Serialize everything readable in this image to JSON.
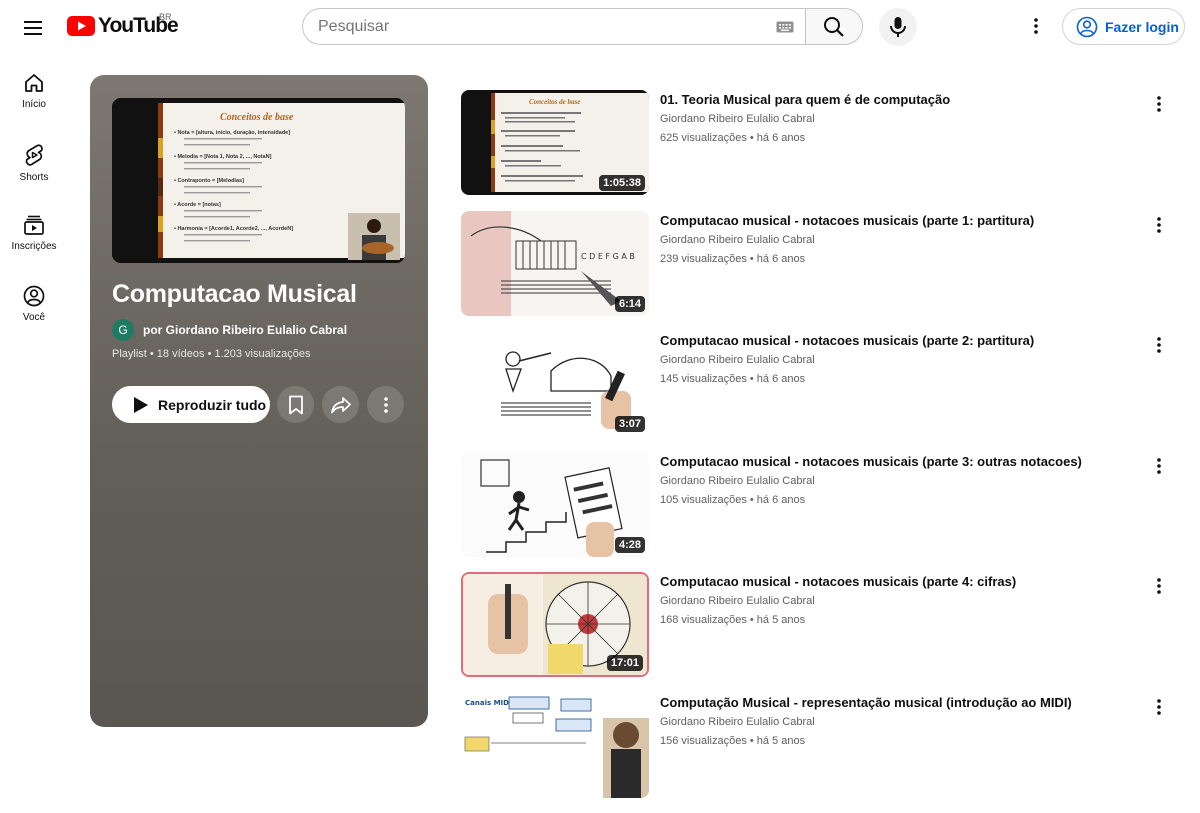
{
  "header": {
    "logo_text": "YouTube",
    "region": "BR",
    "search_placeholder": "Pesquisar",
    "login_label": "Fazer login"
  },
  "sidebar": {
    "items": [
      {
        "label": "Início",
        "icon": "home-icon"
      },
      {
        "label": "Shorts",
        "icon": "shorts-icon"
      },
      {
        "label": "Inscrições",
        "icon": "subscriptions-icon"
      },
      {
        "label": "Você",
        "icon": "you-icon"
      }
    ]
  },
  "playlist": {
    "title": "Computacao Musical",
    "owner_initial": "G",
    "owner": "por Giordano Ribeiro Eulalio Cabral",
    "meta": "Playlist • 18 vídeos • 1.203 visualizações",
    "play_all_label": "Reproduzir tudo",
    "thumb": {
      "heading": "Conceitos de base",
      "lines": [
        "Nota = [altura, início, duração, intensidade]",
        "Melodia = [Nota 1, Nota 2, ..., NotaN]",
        "Contraponto = [Melodias]",
        "Acorde = [notas]",
        "Harmonia = [Acorde1, Acorde2, ..., AcordeN]"
      ]
    }
  },
  "videos": [
    {
      "title": "01. Teoria Musical para quem é de computação",
      "channel": "Giordano Ribeiro Eulalio Cabral",
      "stats": "625 visualizações • há 6 anos",
      "duration": "1:05:38",
      "thumb": "slides"
    },
    {
      "title": "Computacao musical - notacoes musicais (parte 1: partitura)",
      "channel": "Giordano Ribeiro Eulalio Cabral",
      "stats": "239 visualizações • há 6 anos",
      "duration": "6:14",
      "thumb": "sketch-piano"
    },
    {
      "title": "Computacao musical - notacoes musicais (parte 2: partitura)",
      "channel": "Giordano Ribeiro Eulalio Cabral",
      "stats": "145 visualizações • há 6 anos",
      "duration": "3:07",
      "thumb": "sketch-violin"
    },
    {
      "title": "Computacao musical - notacoes musicais (parte 3: outras notacoes)",
      "channel": "Giordano Ribeiro Eulalio Cabral",
      "stats": "105 visualizações • há 6 anos",
      "duration": "4:28",
      "thumb": "sketch-stairs"
    },
    {
      "title": "Computacao musical - notacoes musicais (parte 4: cifras)",
      "channel": "Giordano Ribeiro Eulalio Cabral",
      "stats": "168 visualizações • há 5 anos",
      "duration": "17:01",
      "thumb": "sketch-wheel"
    },
    {
      "title": "Computação Musical - representação musical (introdução ao MIDI)",
      "channel": "Giordano Ribeiro Eulalio Cabral",
      "stats": "156 visualizações • há 5 anos",
      "duration": "",
      "thumb": "midi-diagram"
    }
  ]
}
